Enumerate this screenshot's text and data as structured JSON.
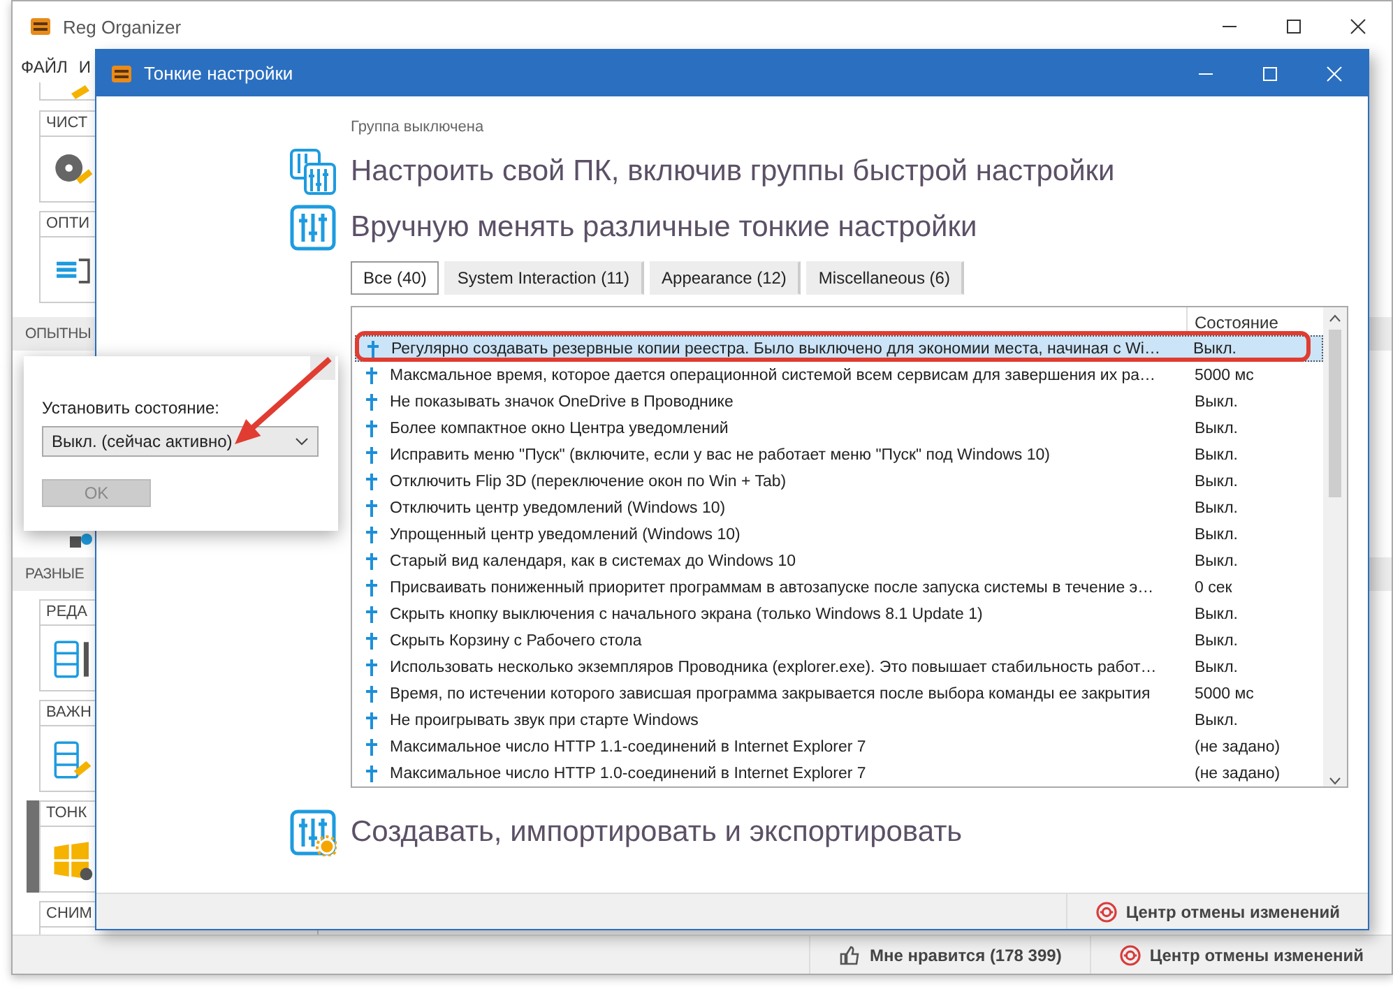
{
  "main_window": {
    "title": "Reg Organizer",
    "menu": [
      "ФАЙЛ",
      "И"
    ],
    "sidebar": [
      {
        "kind": "partial"
      },
      {
        "kind": "card",
        "label": "ЧИСТ",
        "selected": false
      },
      {
        "kind": "card",
        "label": "ОПТИ",
        "selected": false
      },
      {
        "kind": "section",
        "label": "ОПЫТНЫ"
      },
      {
        "kind": "covered"
      },
      {
        "kind": "section",
        "label": "РАЗНЫЕ"
      },
      {
        "kind": "card",
        "label": "РЕДА",
        "selected": false
      },
      {
        "kind": "card",
        "label": "ВАЖН",
        "selected": false
      },
      {
        "kind": "card",
        "label": "ТОНК",
        "selected": true
      },
      {
        "kind": "card",
        "label": "СНИМ",
        "selected": false
      }
    ],
    "status_bar": {
      "like": "Мне нравится (178 399)",
      "undo": "Центр отмены изменений"
    }
  },
  "dialog": {
    "title": "Тонкие настройки",
    "group_note": "Группа выключена",
    "sections": [
      {
        "kind": "quick",
        "title": "Настроить свой ПК, включив группы быстрой настройки"
      },
      {
        "kind": "manual",
        "title": "Вручную менять различные тонкие настройки"
      }
    ],
    "tabs": [
      {
        "label": "Все (40)",
        "selected": true
      },
      {
        "label": "System Interaction (11)",
        "selected": false
      },
      {
        "label": "Appearance (12)",
        "selected": false
      },
      {
        "label": "Miscellaneous (6)",
        "selected": false
      }
    ],
    "table": {
      "columns": [
        "Состояние"
      ],
      "rows": [
        {
          "name": "Регулярно создавать резервные копии реестра. Было выключено для экономии места, начиная с Wi…",
          "state": "Выкл.",
          "selected": true
        },
        {
          "name": "Максмальное время, которое дается операционной системой всем сервисам для завершения их ра…",
          "state": "5000 мс",
          "selected": false
        },
        {
          "name": "Не показывать значок OneDrive в Проводнике",
          "state": "Выкл.",
          "selected": false
        },
        {
          "name": "Более компактное окно Центра уведомлений",
          "state": "Выкл.",
          "selected": false
        },
        {
          "name": "Исправить меню \"Пуск\" (включите, если у вас не работает меню \"Пуск\" под Windows 10)",
          "state": "Выкл.",
          "selected": false
        },
        {
          "name": "Отключить Flip 3D (переключение окон по Win + Tab)",
          "state": "Выкл.",
          "selected": false
        },
        {
          "name": "Отключить центр уведомлений (Windows 10)",
          "state": "Выкл.",
          "selected": false
        },
        {
          "name": "Упрощенный центр уведомлений (Windows 10)",
          "state": "Выкл.",
          "selected": false
        },
        {
          "name": "Старый вид календаря, как в системах до Windows 10",
          "state": "Выкл.",
          "selected": false
        },
        {
          "name": "Присваивать пониженный приоритет программам в автозапуске после запуска системы в течение э…",
          "state": "0 сек",
          "selected": false
        },
        {
          "name": "Скрыть кнопку выключения с начального экрана (только Windows 8.1 Update 1)",
          "state": "Выкл.",
          "selected": false
        },
        {
          "name": "Скрыть Корзину с Рабочего стола",
          "state": "Выкл.",
          "selected": false
        },
        {
          "name": "Использовать несколько экземпляров Проводника (explorer.exe). Это повышает стабильность работ…",
          "state": "Выкл.",
          "selected": false
        },
        {
          "name": "Время, по истечении которого зависшая программа закрывается после выбора команды ее закрытия",
          "state": "5000 мс",
          "selected": false
        },
        {
          "name": "Не проигрывать звук при старте Windows",
          "state": "Выкл.",
          "selected": false
        },
        {
          "name": "Максимальное число HTTP 1.1-соединений в Internet Explorer 7",
          "state": "(не задано)",
          "selected": false
        },
        {
          "name": "Максимальное число HTTP 1.0-соединений в Internet Explorer 7",
          "state": "(не задано)",
          "selected": false
        }
      ]
    },
    "bottom_section": {
      "title": "Создавать, импортировать и экспортировать"
    },
    "status_bar": {
      "undo": "Центр отмены изменений"
    }
  },
  "popup": {
    "label": "Установить состояние:",
    "dropdown": {
      "value": "Выкл. (сейчас активно)"
    },
    "ok_button": {
      "label": "OK",
      "disabled": true
    }
  }
}
